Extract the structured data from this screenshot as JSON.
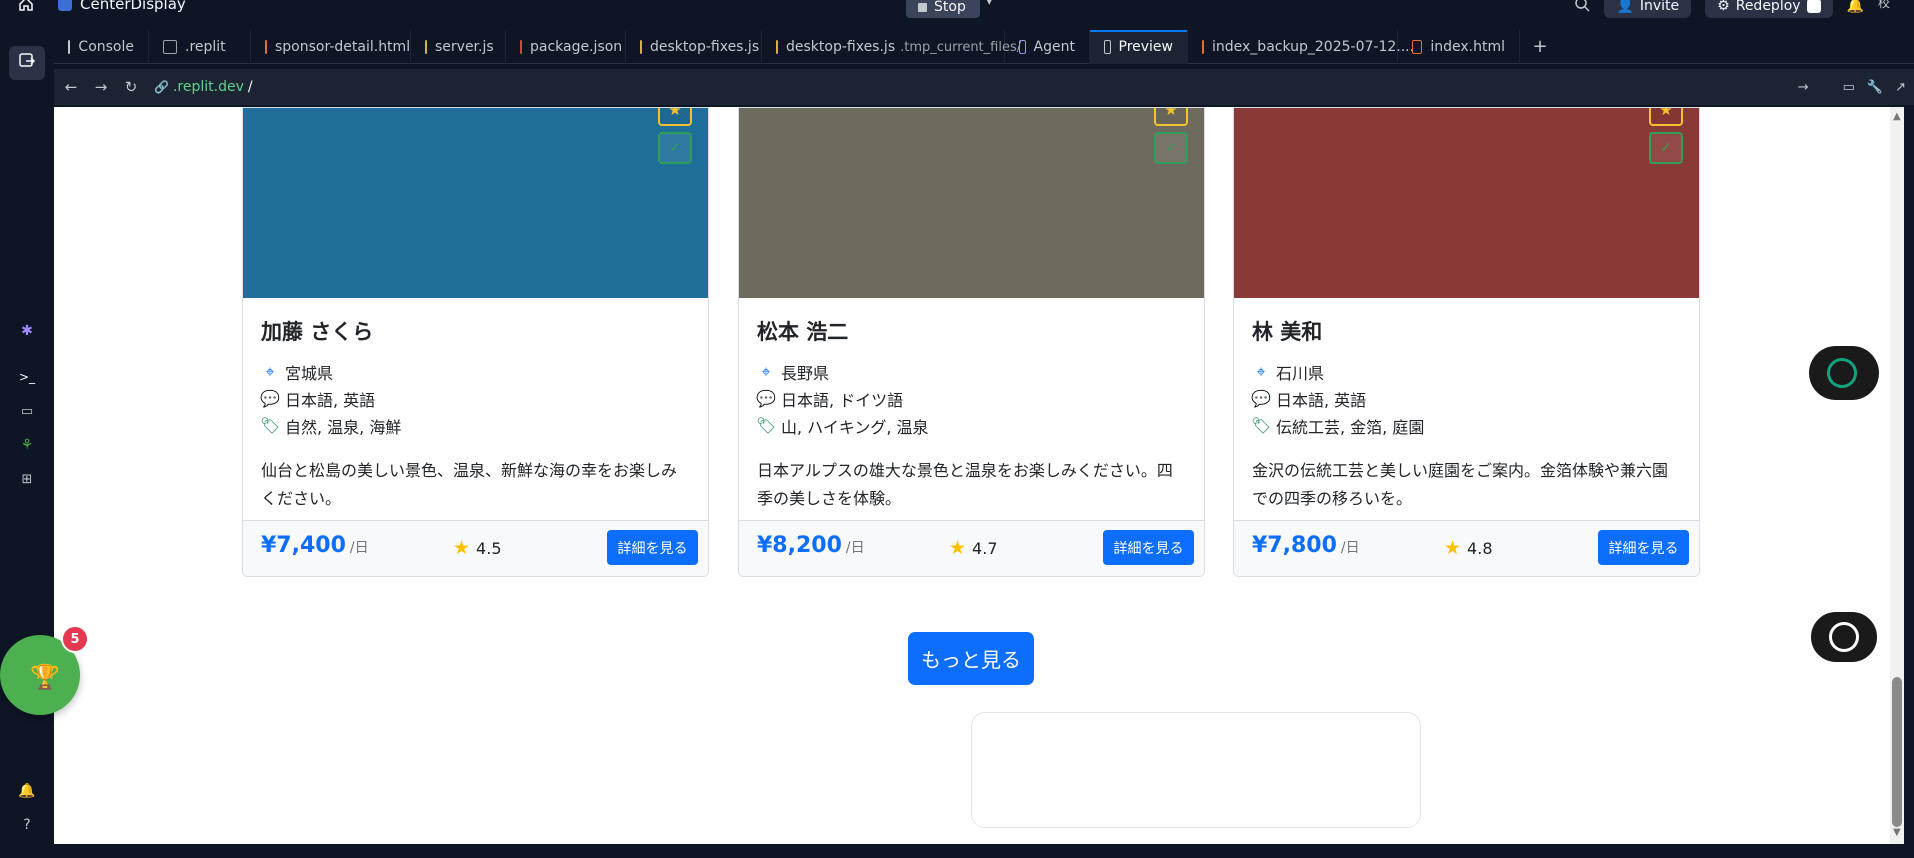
{
  "window": {
    "app_title": "CenterDisplay",
    "stop_label": "Stop",
    "invite_label": "Invite",
    "redeploy_label": "Redeploy",
    "avatar_text": "校"
  },
  "tabs": [
    {
      "label": "Console",
      "icon": "console-icon",
      "sub": ""
    },
    {
      "label": ".replit",
      "icon": "replit-file-icon",
      "sub": ""
    },
    {
      "label": "sponsor-detail.html",
      "icon": "html-file-icon",
      "sub": ""
    },
    {
      "label": "server.js",
      "icon": "js-file-icon",
      "sub": ""
    },
    {
      "label": "package.json",
      "icon": "json-file-icon",
      "sub": ""
    },
    {
      "label": "desktop-fixes.js",
      "icon": "js-file-icon",
      "sub": ""
    },
    {
      "label": "desktop-fixes.js",
      "icon": "js-file-icon",
      "sub": ".tmp_current_files/"
    },
    {
      "label": "Agent",
      "icon": "agent-icon",
      "sub": ""
    },
    {
      "label": "Preview",
      "icon": "preview-icon",
      "sub": ""
    },
    {
      "label": "index_backup_2025-07-12....",
      "icon": "html-file-icon",
      "sub": ""
    },
    {
      "label": "index.html",
      "icon": "html-file-icon",
      "sub": ""
    }
  ],
  "url": {
    "host": ".replit.dev",
    "path": "/"
  },
  "guides": [
    {
      "name": "加藤 さくら",
      "location": "宮城県",
      "languages": "日本語, 英語",
      "tags": "自然, 温泉, 海鮮",
      "description": "仙台と松島の美しい景色、温泉、新鮮な海の幸をお楽しみください。",
      "price": "¥7,400",
      "unit": "/日",
      "rating": "4.5",
      "button": "詳細を見る",
      "photo_bg": "#1f6f9a"
    },
    {
      "name": "松本 浩二",
      "location": "長野県",
      "languages": "日本語, ドイツ語",
      "tags": "山, ハイキング, 温泉",
      "description": "日本アルプスの雄大な景色と温泉をお楽しみください。四季の美しさを体験。",
      "price": "¥8,200",
      "unit": "/日",
      "rating": "4.7",
      "button": "詳細を見る",
      "photo_bg": "#6e6a5e"
    },
    {
      "name": "林 美和",
      "location": "石川県",
      "languages": "日本語, 英語",
      "tags": "伝統工芸, 金箔, 庭園",
      "description": "金沢の伝統工芸と美しい庭園をご案内。金箔体験や兼六園での四季の移ろいを。",
      "price": "¥7,800",
      "unit": "/日",
      "rating": "4.8",
      "button": "詳細を見る",
      "photo_bg": "#8a3a36"
    }
  ],
  "more_button": "もっと見る",
  "badge_count": "5",
  "colors": {
    "accent": "#0d6efd",
    "star": "#ffc107",
    "ide_bg": "#0e1525"
  }
}
